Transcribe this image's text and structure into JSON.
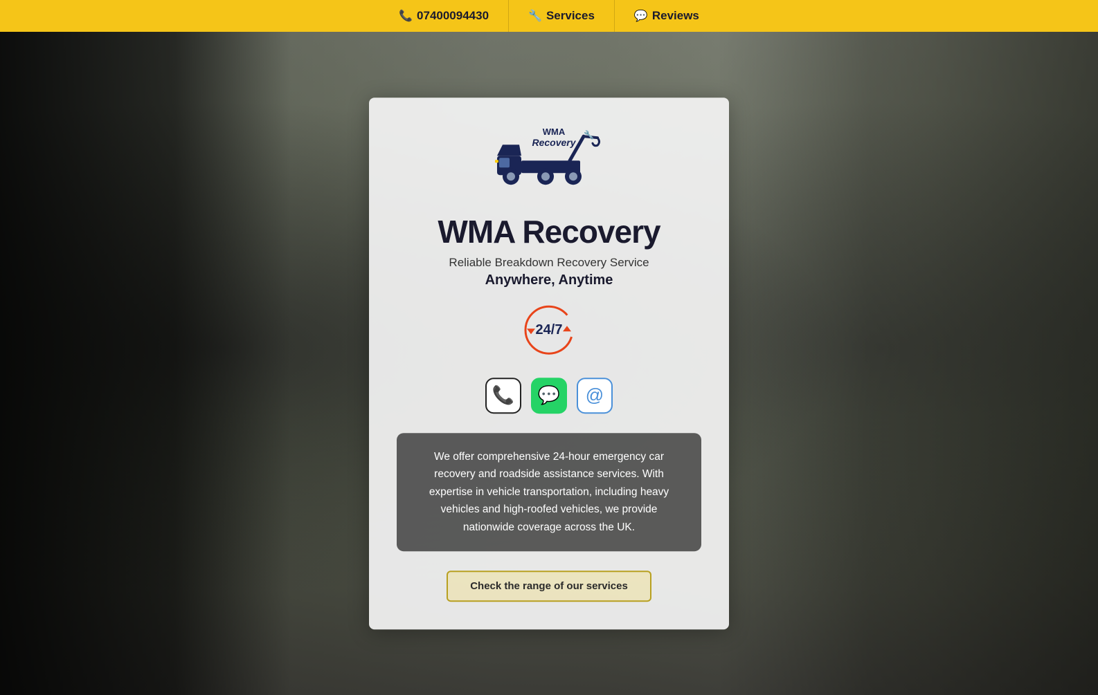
{
  "navbar": {
    "phone_icon": "📞",
    "phone_number": "07400094430",
    "services_icon": "🔧",
    "services_label": "Services",
    "reviews_icon": "💬",
    "reviews_label": "Reviews"
  },
  "card": {
    "company_name": "WMA Recovery",
    "tagline": "Reliable Breakdown Recovery Service",
    "tagline_bold": "Anywhere, Anytime",
    "description": "We offer comprehensive 24-hour emergency car recovery and roadside assistance services. With expertise in vehicle transportation, including heavy vehicles and high-roofed vehicles, we provide nationwide coverage across the UK.",
    "cta_button_label": "Check the range of our services",
    "badge_247": "24/7"
  },
  "colors": {
    "navbar_bg": "#f5c518",
    "card_bg": "rgba(245,245,245,0.92)",
    "description_bg": "rgba(70,70,70,0.88)",
    "cta_border": "#b8a020"
  }
}
